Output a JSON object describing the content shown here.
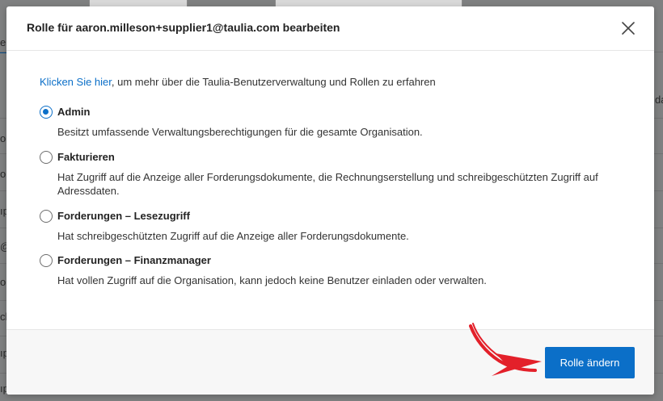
{
  "dialog": {
    "title": "Rolle für aaron.milleson+supplier1@taulia.com bearbeiten",
    "intro_link": "Klicken Sie hier",
    "intro_text": ", um mehr über die Taulia-Benutzerverwaltung und Rollen zu erfahren",
    "options": [
      {
        "label": "Admin",
        "description": "Besitzt umfassende Verwaltungsberechtigungen für die gesamte Organisation.",
        "checked": true
      },
      {
        "label": "Fakturieren",
        "description": "Hat Zugriff auf die Anzeige aller Forderungsdokumente, die Rechnungserstellung und schreibgeschützten Zugriff auf Adressdaten.",
        "checked": false
      },
      {
        "label": "Forderungen – Lesezugriff",
        "description": "Hat schreibgeschützten Zugriff auf die Anzeige aller Forderungsdokumente.",
        "checked": false
      },
      {
        "label": "Forderungen – Finanzmanager",
        "description": "Hat vollen Zugriff auf die Organisation, kann jedoch keine Benutzer einladen oder verwalten.",
        "checked": false
      }
    ],
    "submit_label": "Rolle ändern"
  },
  "background": {
    "left_fragments": [
      "er",
      "op",
      "or",
      "ıp",
      "@",
      "on",
      "ck",
      "ıp",
      "ıp"
    ],
    "right_fragment": "da"
  },
  "colors": {
    "accent": "#0b6fc8",
    "annotation_arrow": "#e3202a"
  },
  "icons": {
    "close": "close-icon",
    "annotation": "red-arrow-annotation"
  }
}
